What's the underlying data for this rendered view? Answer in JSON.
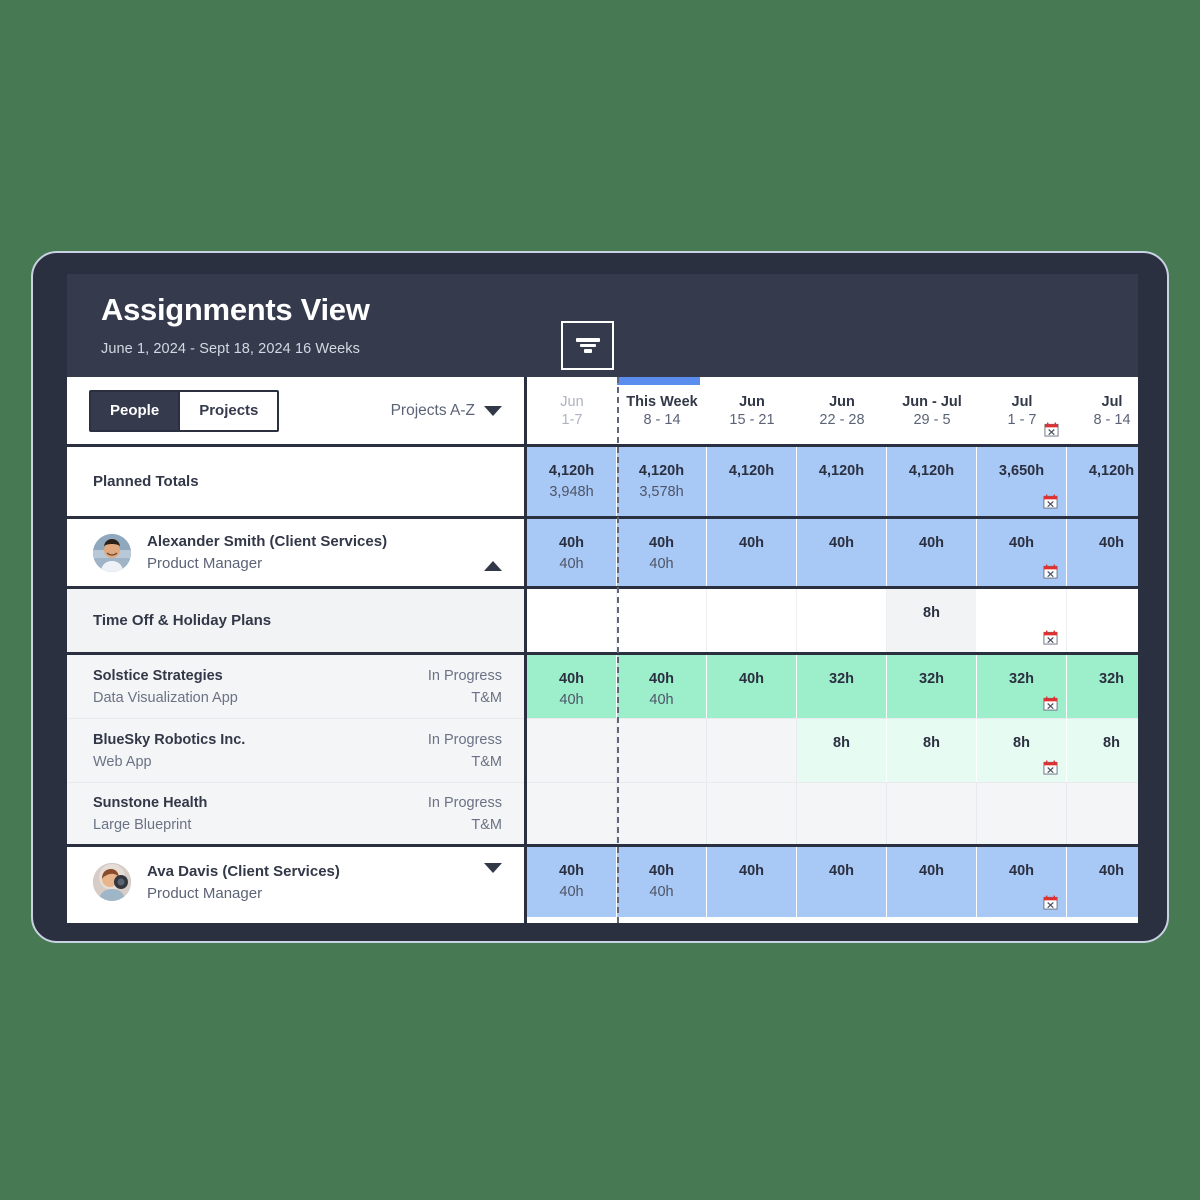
{
  "header": {
    "title": "Assignments View",
    "subtitle": "June 1, 2024 - Sept 18, 2024  16 Weeks",
    "filter_icon": "filter-icon"
  },
  "toolbar": {
    "segments": [
      {
        "label": "People",
        "active": true
      },
      {
        "label": "Projects",
        "active": false
      }
    ],
    "sort_label": "Projects A-Z",
    "sort_caret": "chevron-down-icon"
  },
  "columns": [
    {
      "top": "Jun",
      "bottom": "1-7",
      "past": true,
      "current": false,
      "calendar": false
    },
    {
      "top": "This Week",
      "bottom": "8 - 14",
      "past": false,
      "current": true,
      "calendar": false
    },
    {
      "top": "Jun",
      "bottom": "15 - 21",
      "past": false,
      "current": false,
      "calendar": false
    },
    {
      "top": "Jun",
      "bottom": "22 - 28",
      "past": false,
      "current": false,
      "calendar": false
    },
    {
      "top": "Jun - Jul",
      "bottom": "29 - 5",
      "past": false,
      "current": false,
      "calendar": false
    },
    {
      "top": "Jul",
      "bottom": "1 - 7",
      "past": false,
      "current": false,
      "calendar": true
    },
    {
      "top": "Jul",
      "bottom": "8 - 14",
      "past": false,
      "current": false,
      "calendar": false
    }
  ],
  "rows": [
    {
      "kind": "totals",
      "label": "Planned Totals",
      "cells": [
        {
          "v1": "4,120h",
          "v2": "3,948h",
          "tone": "blue"
        },
        {
          "v1": "4,120h",
          "v2": "3,578h",
          "tone": "blue"
        },
        {
          "v1": "4,120h",
          "v2": "",
          "tone": "blue"
        },
        {
          "v1": "4,120h",
          "v2": "",
          "tone": "blue"
        },
        {
          "v1": "4,120h",
          "v2": "",
          "tone": "blue"
        },
        {
          "v1": "3,650h",
          "v2": "",
          "tone": "blue",
          "calendar": true
        },
        {
          "v1": "4,120h",
          "v2": "",
          "tone": "blue"
        }
      ]
    },
    {
      "kind": "person",
      "name": "Alexander Smith (Client Services)",
      "role": "Product Manager",
      "avatar": "avatar-alexander-smith",
      "expanded": true,
      "cells": [
        {
          "v1": "40h",
          "v2": "40h",
          "tone": "blue"
        },
        {
          "v1": "40h",
          "v2": "40h",
          "tone": "blue"
        },
        {
          "v1": "40h",
          "v2": "",
          "tone": "blue"
        },
        {
          "v1": "40h",
          "v2": "",
          "tone": "blue"
        },
        {
          "v1": "40h",
          "v2": "",
          "tone": "blue"
        },
        {
          "v1": "40h",
          "v2": "",
          "tone": "blue",
          "calendar": true
        },
        {
          "v1": "40h",
          "v2": "",
          "tone": "blue"
        }
      ]
    },
    {
      "kind": "timeoff",
      "label": "Time Off & Holiday Plans",
      "cells": [
        {
          "v1": "",
          "v2": "",
          "tone": "white"
        },
        {
          "v1": "",
          "v2": "",
          "tone": "white"
        },
        {
          "v1": "",
          "v2": "",
          "tone": "white"
        },
        {
          "v1": "",
          "v2": "",
          "tone": "white"
        },
        {
          "v1": "8h",
          "v2": "",
          "tone": "grey"
        },
        {
          "v1": "",
          "v2": "",
          "tone": "white",
          "calendar": true
        },
        {
          "v1": "",
          "v2": "",
          "tone": "white"
        }
      ]
    },
    {
      "kind": "project",
      "name": "Solstice Strategies",
      "sub": "Data Visualization App",
      "status": "In Progress",
      "type": "T&M",
      "cells": [
        {
          "v1": "40h",
          "v2": "40h",
          "tone": "green"
        },
        {
          "v1": "40h",
          "v2": "40h",
          "tone": "green"
        },
        {
          "v1": "40h",
          "v2": "",
          "tone": "green"
        },
        {
          "v1": "32h",
          "v2": "",
          "tone": "green"
        },
        {
          "v1": "32h",
          "v2": "",
          "tone": "green"
        },
        {
          "v1": "32h",
          "v2": "",
          "tone": "green",
          "calendar": true
        },
        {
          "v1": "32h",
          "v2": "",
          "tone": "green"
        }
      ]
    },
    {
      "kind": "project",
      "name": "BlueSky Robotics Inc.",
      "sub": "Web App",
      "status": "In Progress",
      "type": "T&M",
      "cells": [
        {
          "v1": "",
          "v2": "",
          "tone": "greyl"
        },
        {
          "v1": "",
          "v2": "",
          "tone": "greyl"
        },
        {
          "v1": "",
          "v2": "",
          "tone": "greyl"
        },
        {
          "v1": "8h",
          "v2": "",
          "tone": "mint"
        },
        {
          "v1": "8h",
          "v2": "",
          "tone": "mint"
        },
        {
          "v1": "8h",
          "v2": "",
          "tone": "mint",
          "calendar": true
        },
        {
          "v1": "8h",
          "v2": "",
          "tone": "mint"
        }
      ]
    },
    {
      "kind": "project",
      "name": "Sunstone Health",
      "sub": "Large Blueprint",
      "status": "In Progress",
      "type": "T&M",
      "cells": [
        {
          "v1": "",
          "v2": "",
          "tone": "greyl"
        },
        {
          "v1": "",
          "v2": "",
          "tone": "greyl"
        },
        {
          "v1": "",
          "v2": "",
          "tone": "greyl"
        },
        {
          "v1": "",
          "v2": "",
          "tone": "greyl"
        },
        {
          "v1": "",
          "v2": "",
          "tone": "greyl"
        },
        {
          "v1": "",
          "v2": "",
          "tone": "greyl"
        },
        {
          "v1": "",
          "v2": "",
          "tone": "greyl"
        }
      ]
    },
    {
      "kind": "person",
      "name": "Ava Davis (Client Services)",
      "role": "Product Manager",
      "avatar": "avatar-ava-davis",
      "expanded": false,
      "cells": [
        {
          "v1": "40h",
          "v2": "40h",
          "tone": "blue"
        },
        {
          "v1": "40h",
          "v2": "40h",
          "tone": "blue"
        },
        {
          "v1": "40h",
          "v2": "",
          "tone": "blue"
        },
        {
          "v1": "40h",
          "v2": "",
          "tone": "blue"
        },
        {
          "v1": "40h",
          "v2": "",
          "tone": "blue"
        },
        {
          "v1": "40h",
          "v2": "",
          "tone": "blue",
          "calendar": true
        },
        {
          "v1": "40h",
          "v2": "",
          "tone": "blue"
        }
      ]
    }
  ],
  "colors": {
    "background": "#477a52",
    "frame": "#2b3040",
    "header": "#353b4d",
    "accent_blue": "#5b8def",
    "cell_blue": "#a8c8f6",
    "cell_green": "#9defcb",
    "cell_mint": "#e6fbf2",
    "calendar_red": "#e03030"
  }
}
